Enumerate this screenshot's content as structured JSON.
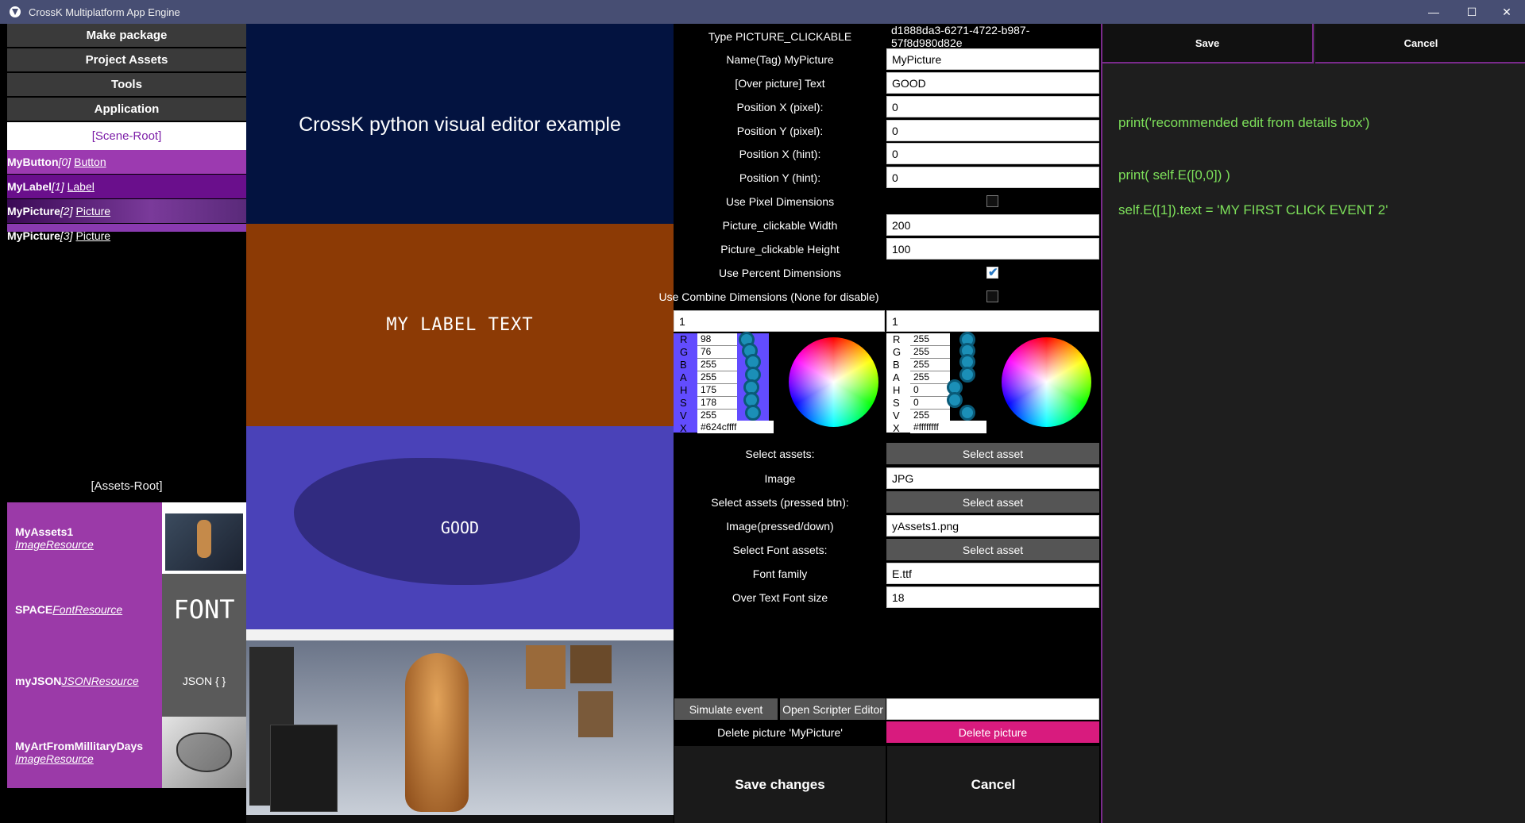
{
  "window": {
    "title": "CrossK Multiplatform App Engine",
    "minimize": "—",
    "maximize": "☐",
    "close": "✕"
  },
  "menu": [
    "Make package",
    "Project Assets",
    "Tools",
    "Application"
  ],
  "scene_tree": {
    "root": "[Scene-Root]",
    "items": [
      {
        "name": "MyButton",
        "index": "[0]",
        "type": "Button"
      },
      {
        "name": "MyLabel",
        "index": "[1]",
        "type": "Label"
      },
      {
        "name": "MyPicture",
        "index": "[2]",
        "type": "Picture"
      },
      {
        "name": "MyPicture",
        "index": "[3]",
        "type": "Picture"
      }
    ]
  },
  "assets": {
    "root": "[Assets-Root]",
    "items": [
      {
        "name": "MyAssets1",
        "type": "ImageResource",
        "thumb": ""
      },
      {
        "name": "SPACE",
        "type": "FontResource",
        "thumb": "FONT"
      },
      {
        "name": "myJSON",
        "type": "JSONResource",
        "thumb": "JSON { }"
      },
      {
        "name": "MyArtFromMillitaryDays",
        "type": "ImageResource",
        "thumb": ""
      }
    ]
  },
  "canvas": {
    "heading": "CrossK python visual editor example",
    "label_text": "MY LABEL TEXT",
    "picture_text": "GOOD"
  },
  "properties": {
    "type_label": "Type PICTURE_CLICKABLE",
    "type_id": "d1888da3-6271-4722-b987-57f8d980d82e",
    "name_label": "Name(Tag) MyPicture",
    "name_value": "MyPicture",
    "text_label": "[Over picture] Text",
    "text_value": "GOOD",
    "pos_x_px_label": "Position X (pixel):",
    "pos_x_px": "0",
    "pos_y_px_label": "Position Y (pixel):",
    "pos_y_px": "0",
    "pos_x_hint_label": "Position X (hint):",
    "pos_x_hint": "0",
    "pos_y_hint_label": "Position Y (hint):",
    "pos_y_hint": "0",
    "use_pixel_label": "Use Pixel Dimensions",
    "width_label": "Picture_clickable Width",
    "width_value": "200",
    "height_label": "Picture_clickable Height",
    "height_value": "100",
    "use_percent_label": "Use Percent Dimensions",
    "use_combine_label": "Use Combine Dimensions (None for disable)",
    "combine_a": "1",
    "combine_b": "1",
    "select_assets_label": "Select assets:",
    "select_asset_btn": "Select asset",
    "image_label": "Image",
    "image_value": "JPG",
    "select_pressed_label": "Select assets (pressed btn):",
    "pressed_label": "Image(pressed/down)",
    "pressed_value": "yAssets1.png",
    "select_font_label": "Select Font assets:",
    "font_family_label": "Font family",
    "font_family_value": "E.ttf",
    "font_size_label": "Over Text Font size",
    "font_size_value": "18"
  },
  "color_pickers": [
    {
      "channels": [
        "R",
        "G",
        "B",
        "A",
        "H",
        "S",
        "V",
        "X"
      ],
      "values": [
        "98",
        "76",
        "255",
        "255",
        "175",
        "178",
        "255"
      ],
      "hex": "#624cffff",
      "color": "#624cff"
    },
    {
      "channels": [
        "R",
        "G",
        "B",
        "A",
        "H",
        "S",
        "V",
        "X"
      ],
      "values": [
        "255",
        "255",
        "255",
        "255",
        "0",
        "0",
        "255"
      ],
      "hex": "#ffffffff",
      "color": "#ffffff"
    }
  ],
  "footer": {
    "simulate": "Simulate event",
    "open_scripter": "Open Scripter Editor",
    "delete_label": "Delete picture 'MyPicture'",
    "delete_btn": "Delete picture",
    "save": "Save changes",
    "cancel": "Cancel"
  },
  "code_editor": {
    "save": "Save",
    "cancel": "Cancel",
    "lines": [
      "print('recommended edit from details box')",
      "print( self.E([0,0]) )",
      "self.E([1]).text = 'MY FIRST CLICK EVENT 2'"
    ]
  }
}
